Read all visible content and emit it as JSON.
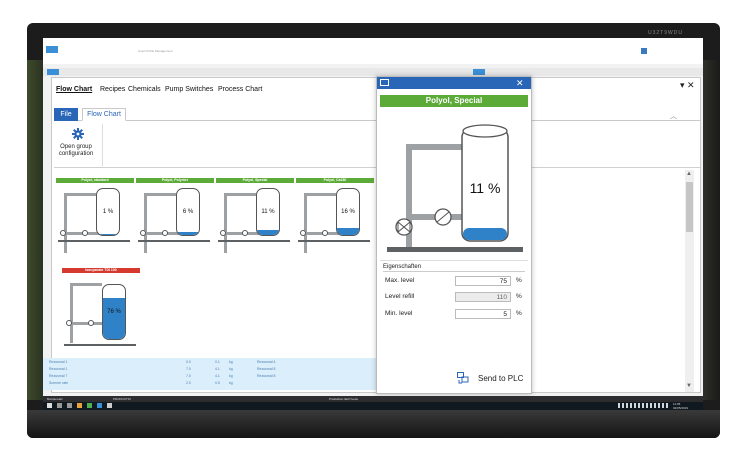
{
  "monitor": {
    "brand": "U32T9WDU"
  },
  "background_app": {
    "title": "Ampl Profile Management"
  },
  "window": {
    "tabs": [
      {
        "label": "Flow Chart"
      },
      {
        "label": "Recipes"
      },
      {
        "label": "Chemicals"
      },
      {
        "label": "Pump Switches"
      },
      {
        "label": "Process Chart"
      }
    ],
    "controls": "▾ ✕",
    "ribbon_tabs": [
      {
        "label": "File"
      },
      {
        "label": "Flow Chart"
      }
    ],
    "ribbon_group": {
      "icon": "gear-icon",
      "label_line1": "Open group",
      "label_line2": "configuration"
    }
  },
  "tiles": [
    {
      "name": "Polyol, standard",
      "level": 1,
      "label": "1 %",
      "header_color": "#5cab39"
    },
    {
      "name": "Polyol, Polymer",
      "level": 6,
      "label": "6 %",
      "header_color": "#5cab39"
    },
    {
      "name": "Polyol, Special",
      "level": 11,
      "label": "11 %",
      "header_color": "#5cab39"
    },
    {
      "name": "Polyol, Ca180",
      "level": 16,
      "label": "16 %",
      "header_color": "#5cab39"
    },
    {
      "name": "Isocyanate TDI 100",
      "level": 76,
      "label": "76 %",
      "header_color": "#d63a2f"
    }
  ],
  "popup": {
    "title_icon": "window-icon",
    "close": "✕",
    "header": "Polyol, Special",
    "level": 11,
    "level_label": "11 %",
    "properties_title": "Eigenschaften",
    "properties": [
      {
        "label": "Max. level",
        "value": "75",
        "unit": "%",
        "readonly": false
      },
      {
        "label": "Level refill",
        "value": "110",
        "unit": "%",
        "readonly": true
      },
      {
        "label": "Min. level",
        "value": "5",
        "unit": "%",
        "readonly": false
      }
    ],
    "send_icon": "plc-send-icon",
    "send_label": "Send to PLC"
  },
  "data_rows": [
    {
      "left": "Rezusmal 1",
      "v1": "0.0",
      "v2": "0.1",
      "u": "kg",
      "right": "Rezusmal 4",
      "v3": "7.0",
      "v4": "4.1",
      "u2": "kg"
    },
    {
      "left": "Rezusmal 1",
      "v1": "7.0",
      "v2": "4.1",
      "u": "kg",
      "right": "Rezusmal 5",
      "v3": "7.0",
      "v4": "4.1",
      "u2": "kg"
    },
    {
      "left": "Rezusmal 7",
      "v1": "7.0",
      "v2": "4.1",
      "u": "kg",
      "right": "Rezusmal 8",
      "v3": "7.0",
      "v4": "4.8",
      "u2": "kg"
    },
    {
      "left": "Summe rate",
      "v1": "2.0",
      "v2": "0.5",
      "u": "kg",
      "right": "",
      "v3": "",
      "v4": "",
      "u2": ""
    }
  ],
  "status": {
    "left": "Beispiel-akt",
    "mid": "PRODUCTIO",
    "center": "Produktion läuft heute",
    "clock_time": "11:05",
    "clock_date": "02/05/2019"
  },
  "colors": {
    "accent": "#2a66b8",
    "tank_fill": "#2f82c8",
    "header_green": "#5cab39",
    "header_red": "#d63a2f"
  }
}
